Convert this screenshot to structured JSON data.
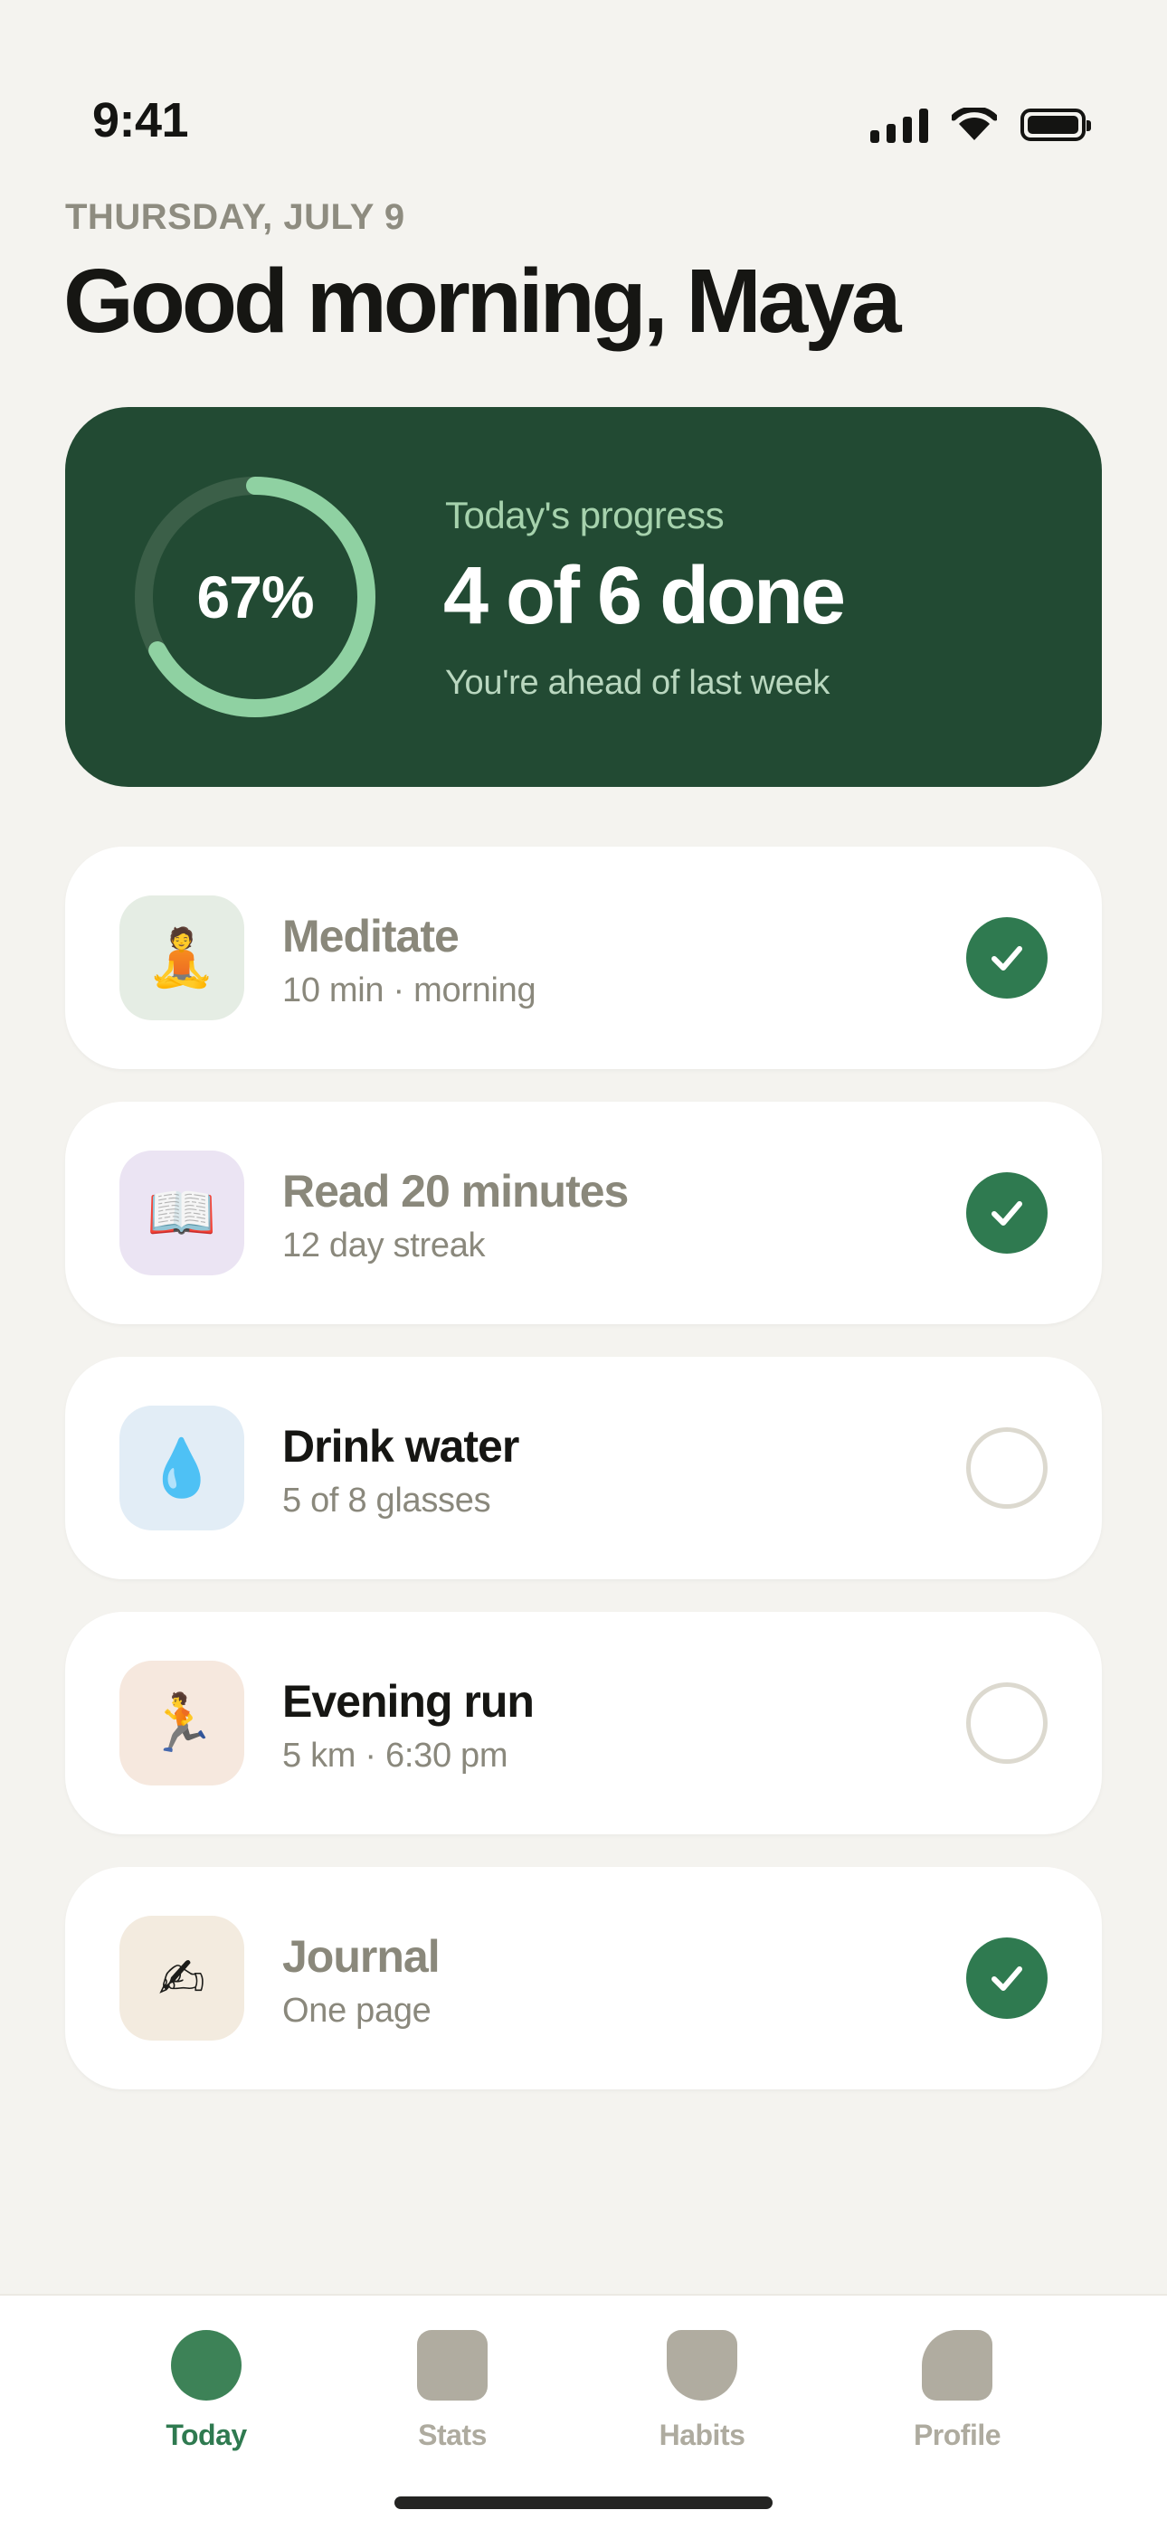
{
  "status_bar": {
    "time": "9:41"
  },
  "header": {
    "date": "THURSDAY, JULY 9",
    "greeting": "Good morning, Maya"
  },
  "progress": {
    "percent_label": "67%",
    "completion_fraction": 0.67,
    "title": "Today's progress",
    "main": "4 of 6 done",
    "subtitle": "You're ahead of last week"
  },
  "habits": [
    {
      "icon": "meditation-icon",
      "emoji": "🧘",
      "name": "Meditate",
      "detail": "10 min · morning",
      "done": true,
      "icon_bg": "#e5ede4"
    },
    {
      "icon": "book-icon",
      "emoji": "📖",
      "name": "Read 20 minutes",
      "detail": "12 day streak",
      "done": true,
      "icon_bg": "#ebe4f3"
    },
    {
      "icon": "water-drop-icon",
      "emoji": "💧",
      "name": "Drink water",
      "detail": "5 of 8 glasses",
      "done": false,
      "icon_bg": "#e2edf6"
    },
    {
      "icon": "runner-icon",
      "emoji": "🏃",
      "name": "Evening run",
      "detail": "5 km · 6:30 pm",
      "done": false,
      "icon_bg": "#f6e8de"
    },
    {
      "icon": "writing-hand-icon",
      "emoji": "✍",
      "name": "Journal",
      "detail": "One page",
      "done": true,
      "icon_bg": "#f3ebdf"
    }
  ],
  "tabs": [
    {
      "label": "Today",
      "icon": "today-icon",
      "active": true
    },
    {
      "label": "Stats",
      "icon": "stats-icon",
      "active": false
    },
    {
      "label": "Habits",
      "icon": "habits-icon",
      "active": false
    },
    {
      "label": "Profile",
      "icon": "profile-icon",
      "active": false
    }
  ],
  "colors": {
    "background": "#f4f3ef",
    "card_dark": "#224a33",
    "accent_green": "#2f7a50",
    "ring_track": "#3b5f48",
    "ring_fill": "#8fd1a2"
  }
}
